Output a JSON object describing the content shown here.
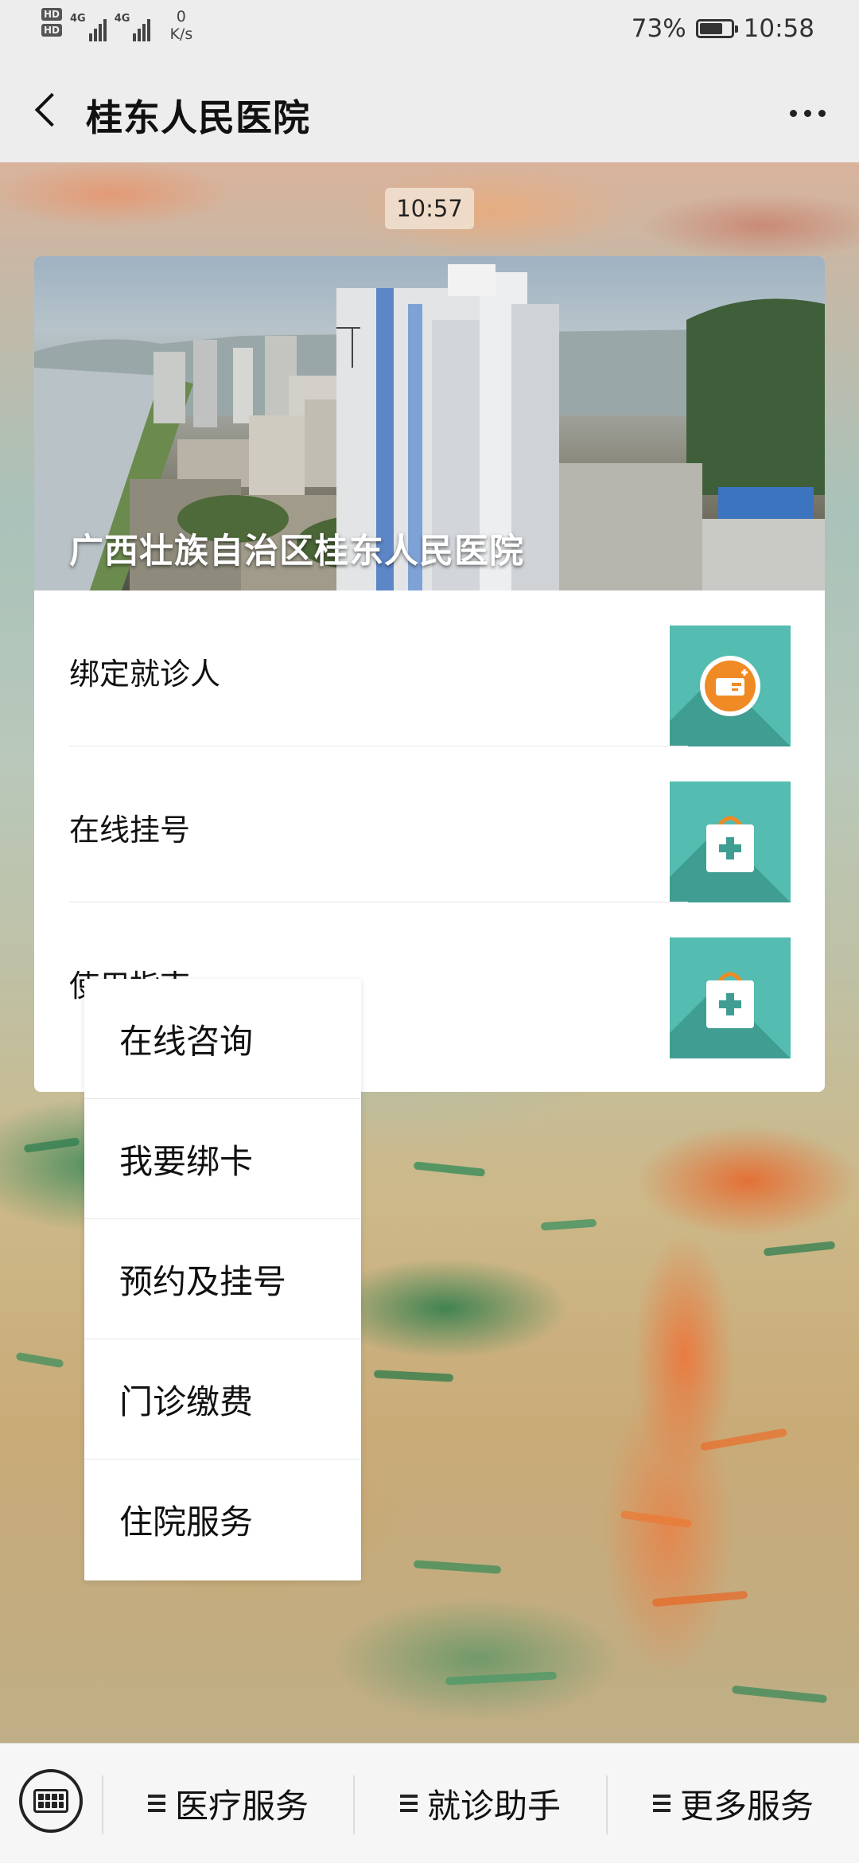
{
  "status_bar": {
    "hd1": "HD",
    "hd2": "HD",
    "net1": "4G",
    "net2": "4G",
    "speed_value": "0",
    "speed_unit": "K/s",
    "battery_percent": "73%",
    "battery_level": 0.73,
    "time": "10:58"
  },
  "header": {
    "title": "桂东人民医院",
    "back_icon": "chevron-left-icon",
    "more_icon": "more-dots-icon"
  },
  "chat": {
    "timestamp": "10:57"
  },
  "article_card": {
    "hero_title": "广西壮族自治区桂东人民医院",
    "items": [
      {
        "label": "绑定就诊人",
        "icon": "id-card-icon",
        "icon_color": "#f08a24"
      },
      {
        "label": "在线挂号",
        "icon": "medical-bag-icon",
        "icon_color": "#ffffff"
      },
      {
        "label": "使用指南",
        "icon": "medical-bag-icon",
        "icon_color": "#ffffff"
      }
    ],
    "thumb_color": "#54bcb0"
  },
  "popup_menu": {
    "items": [
      {
        "label": "在线咨询"
      },
      {
        "label": "我要绑卡"
      },
      {
        "label": "预约及挂号"
      },
      {
        "label": "门诊缴费"
      },
      {
        "label": "住院服务"
      }
    ]
  },
  "bottom_menu": {
    "keyboard_icon": "keyboard-icon",
    "menu_icon": "hamburger-icon",
    "items": [
      {
        "label": "医疗服务"
      },
      {
        "label": "就诊助手"
      },
      {
        "label": "更多服务"
      }
    ]
  }
}
